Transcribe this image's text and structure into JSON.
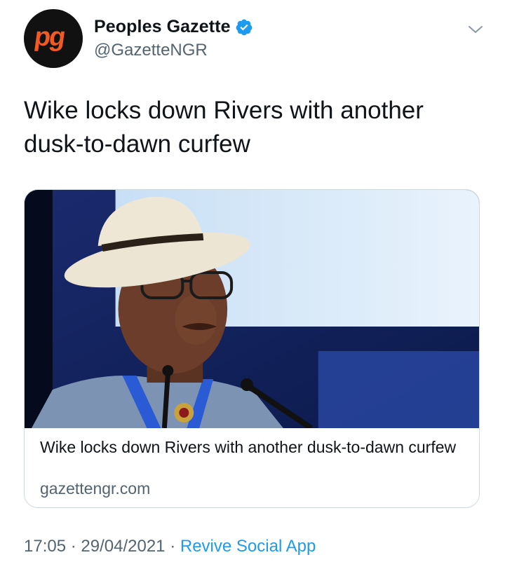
{
  "author": {
    "avatar_text": "pg",
    "display_name": "Peoples Gazette",
    "handle": "@GazetteNGR",
    "verified": true
  },
  "tweet": {
    "text_line1": "Wike locks down Rivers with another",
    "text_line2": "dusk-to-dawn curfew"
  },
  "card": {
    "title": "Wike locks down Rivers with another dusk-to-dawn curfew",
    "domain": "gazettengr.com",
    "image_icon": "photo-man-in-hat-at-microphones"
  },
  "meta": {
    "time": "17:05",
    "separator": "·",
    "date": "29/04/2021",
    "source": "Revive Social App"
  },
  "colors": {
    "accent": "#1d9bf0",
    "secondary_text": "#536471",
    "avatar_bg": "#111111",
    "avatar_logo": "#f15a22"
  },
  "icons": {
    "verified": "verified-badge-icon",
    "menu": "chevron-down-icon"
  }
}
